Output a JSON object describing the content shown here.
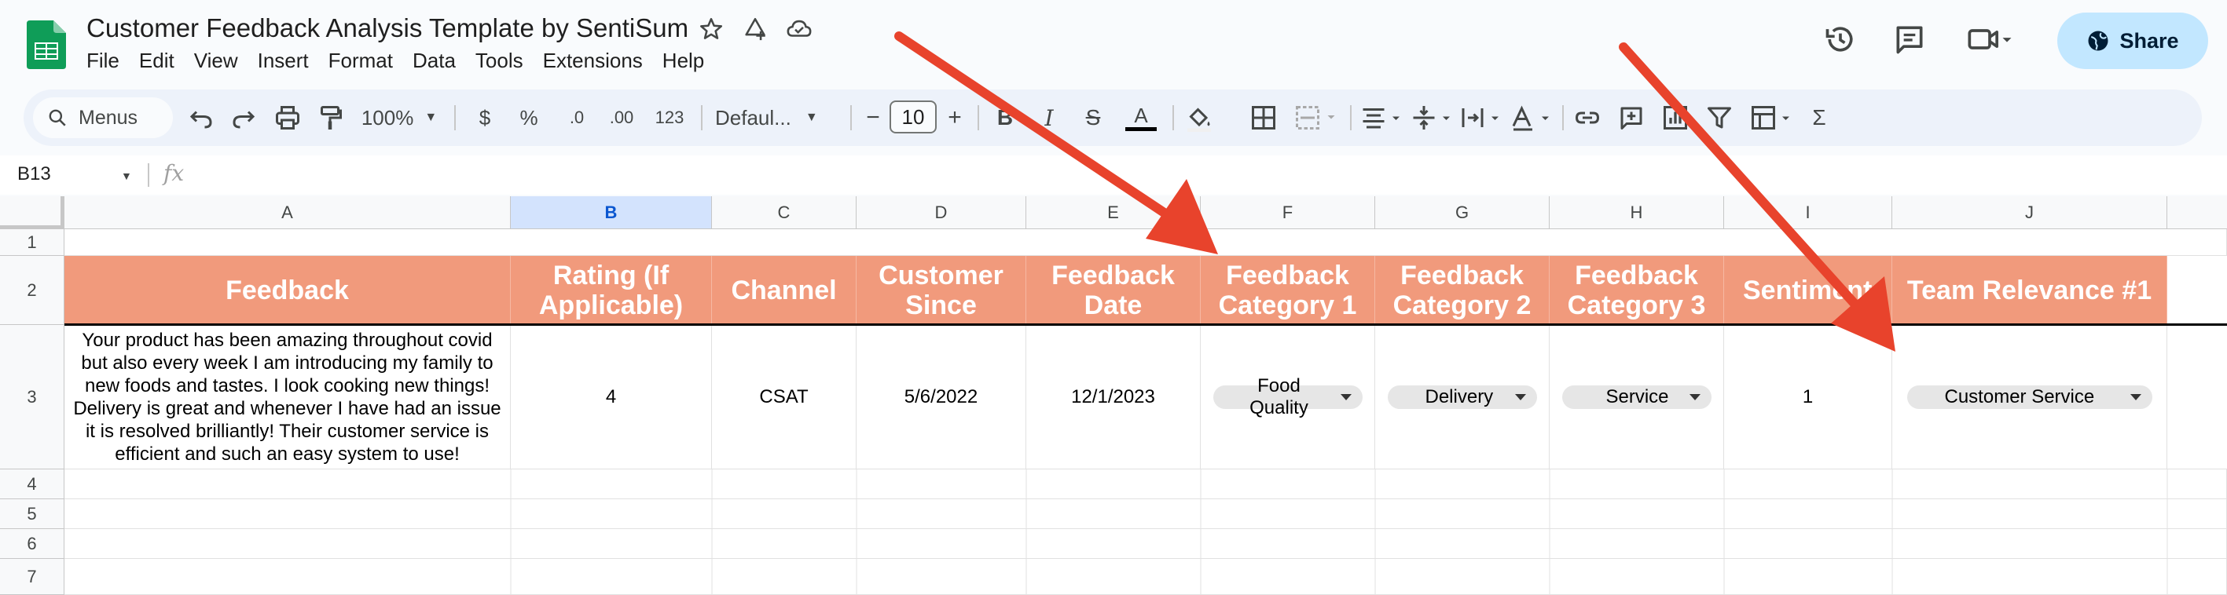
{
  "doc": {
    "title": "Customer Feedback Analysis Template by SentiSum",
    "menu": [
      "File",
      "Edit",
      "View",
      "Insert",
      "Format",
      "Data",
      "Tools",
      "Extensions",
      "Help"
    ],
    "share_label": "Share"
  },
  "toolbar": {
    "menus_label": "Menus",
    "zoom": "100%",
    "currency": "$",
    "percent": "%",
    "dec_decrease": ".0",
    "dec_increase": ".00",
    "number_format": "123",
    "font": "Defaul...",
    "font_size": "10",
    "minus": "−",
    "plus": "+",
    "bold": "B",
    "italic": "I",
    "strike": "S",
    "text_color": "A",
    "sigma": "Σ"
  },
  "formula_bar": {
    "name_box": "B13",
    "fx": "fx"
  },
  "columns": [
    "A",
    "B",
    "C",
    "D",
    "E",
    "F",
    "G",
    "H",
    "I",
    "J"
  ],
  "rows": [
    "1",
    "2",
    "3",
    "4",
    "5",
    "6",
    "7"
  ],
  "header_row": [
    "Feedback",
    "Rating (If Applicable)",
    "Channel",
    "Customer Since",
    "Feedback Date",
    "Feedback Category 1",
    "Feedback Category 2",
    "Feedback Category 3",
    "Sentiment",
    "Team Relevance #1"
  ],
  "data_row": {
    "feedback": "Your product has been amazing throughout covid but also every week I am introducing my family to new foods and tastes. I look cooking new things! Delivery is great and whenever I have had an issue it is resolved brilliantly! Their customer service is efficient and such an easy system to use!",
    "rating": "4",
    "channel": "CSAT",
    "customer_since": "5/6/2022",
    "feedback_date": "12/1/2023",
    "category_1": "Food Quality",
    "category_2": "Delivery",
    "category_3": "Service",
    "sentiment": "1",
    "team_relevance": "Customer Service"
  },
  "colors": {
    "header_fill": "#f19a7c",
    "arrow": "#e8432c",
    "share_bg": "#c2e7ff",
    "selected_col": "#d3e3fd"
  }
}
